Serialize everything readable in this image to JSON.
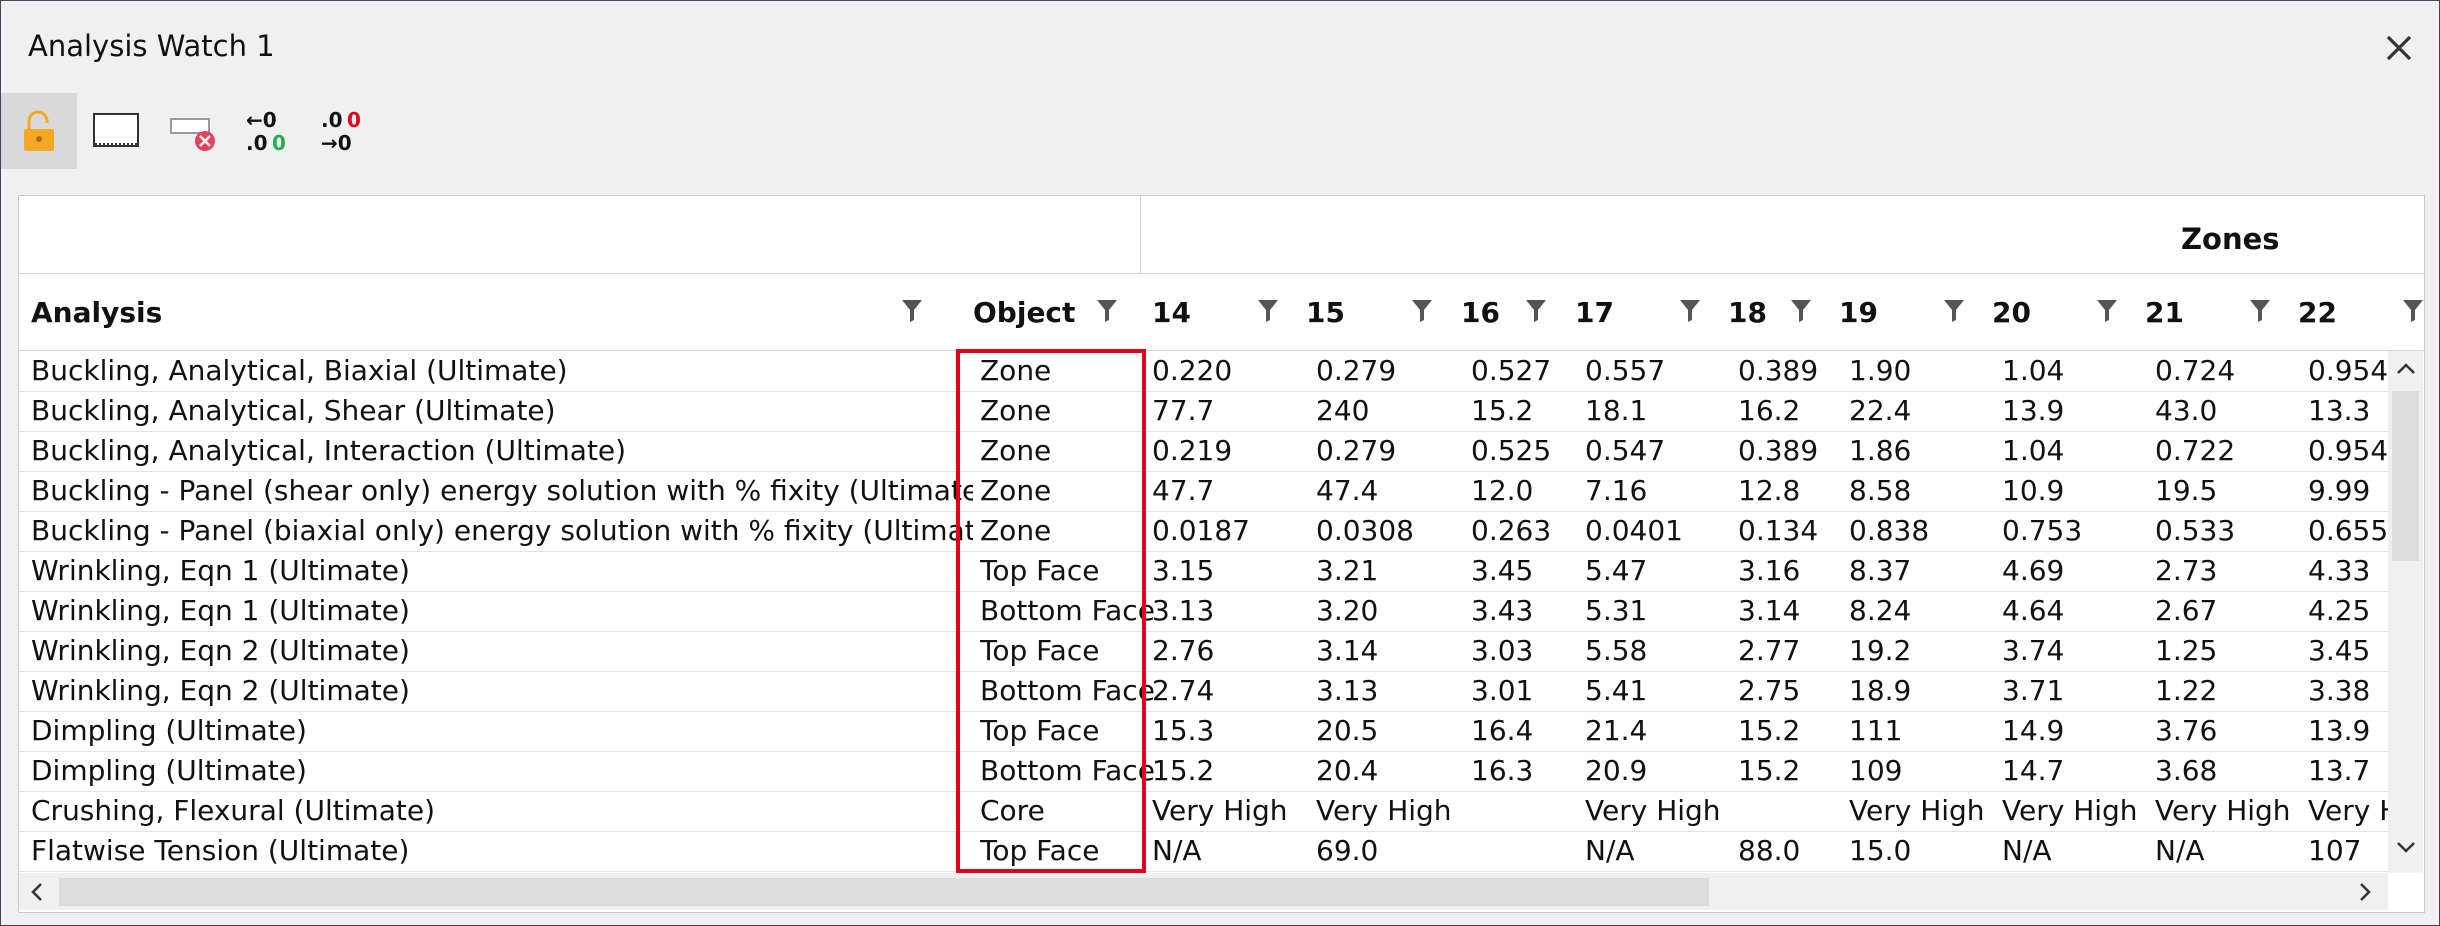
{
  "window": {
    "title": "Analysis Watch 1"
  },
  "toolbar": {
    "buttons": [
      {
        "name": "lock",
        "icon": "unlock-icon",
        "active": true
      },
      {
        "name": "display",
        "icon": "rectangle-dotted-icon",
        "active": false
      },
      {
        "name": "clear",
        "icon": "clear-filter-icon",
        "active": false
      },
      {
        "name": "decrease-decimals",
        "icon": "decrease-decimals-icon",
        "glyph_top": "←0",
        "glyph_prefix": ".0",
        "glyph_accent": "0",
        "active": false
      },
      {
        "name": "increase-decimals",
        "icon": "increase-decimals-icon",
        "glyph_prefix": ".0",
        "glyph_accent": "0",
        "glyph_bottom": "→0",
        "active": false
      }
    ]
  },
  "colors": {
    "accent_orange": "#f5a623",
    "highlight_red": "#e3001b",
    "green": "#22b14c",
    "red": "#e3001b"
  },
  "grid": {
    "band_label": "Zones",
    "columns": [
      "Analysis",
      "Object",
      "14",
      "15",
      "16",
      "17",
      "18",
      "19",
      "20",
      "21",
      "22"
    ],
    "rows": [
      [
        "Buckling, Analytical, Biaxial (Ultimate)",
        "Zone",
        "0.220",
        "0.279",
        "0.527",
        "0.557",
        "0.389",
        "1.90",
        "1.04",
        "0.724",
        "0.954"
      ],
      [
        "Buckling, Analytical, Shear (Ultimate)",
        "Zone",
        "77.7",
        "240",
        "15.2",
        "18.1",
        "16.2",
        "22.4",
        "13.9",
        "43.0",
        "13.3"
      ],
      [
        "Buckling, Analytical, Interaction (Ultimate)",
        "Zone",
        "0.219",
        "0.279",
        "0.525",
        "0.547",
        "0.389",
        "1.86",
        "1.04",
        "0.722",
        "0.954"
      ],
      [
        "Buckling - Panel (shear only) energy solution with % fixity (Ultimate)",
        "Zone",
        "47.7",
        "47.4",
        "12.0",
        "7.16",
        "12.8",
        "8.58",
        "10.9",
        "19.5",
        "9.99"
      ],
      [
        "Buckling - Panel (biaxial only) energy solution with % fixity (Ultimate)",
        "Zone",
        "0.0187",
        "0.0308",
        "0.263",
        "0.0401",
        "0.134",
        "0.838",
        "0.753",
        "0.533",
        "0.655"
      ],
      [
        "Wrinkling, Eqn 1 (Ultimate)",
        "Top Face",
        "3.15",
        "3.21",
        "3.45",
        "5.47",
        "3.16",
        "8.37",
        "4.69",
        "2.73",
        "4.33"
      ],
      [
        "Wrinkling, Eqn 1 (Ultimate)",
        "Bottom Face",
        "3.13",
        "3.20",
        "3.43",
        "5.31",
        "3.14",
        "8.24",
        "4.64",
        "2.67",
        "4.25"
      ],
      [
        "Wrinkling, Eqn 2 (Ultimate)",
        "Top Face",
        "2.76",
        "3.14",
        "3.03",
        "5.58",
        "2.77",
        "19.2",
        "3.74",
        "1.25",
        "3.45"
      ],
      [
        "Wrinkling, Eqn 2 (Ultimate)",
        "Bottom Face",
        "2.74",
        "3.13",
        "3.01",
        "5.41",
        "2.75",
        "18.9",
        "3.71",
        "1.22",
        "3.38"
      ],
      [
        "Dimpling (Ultimate)",
        "Top Face",
        "15.3",
        "20.5",
        "16.4",
        "21.4",
        "15.2",
        "111",
        "14.9",
        "3.76",
        "13.9"
      ],
      [
        "Dimpling (Ultimate)",
        "Bottom Face",
        "15.2",
        "20.4",
        "16.3",
        "20.9",
        "15.2",
        "109",
        "14.7",
        "3.68",
        "13.7"
      ],
      [
        "Crushing, Flexural (Ultimate)",
        "Core",
        "Very High",
        "Very High",
        "",
        "Very High",
        "",
        "Very High",
        "Very High",
        "Very High",
        "Very H"
      ],
      [
        "Flatwise Tension (Ultimate)",
        "Top Face",
        "N/A",
        "69.0",
        "",
        "N/A",
        "88.0",
        "15.0",
        "N/A",
        "N/A",
        "107"
      ]
    ]
  }
}
